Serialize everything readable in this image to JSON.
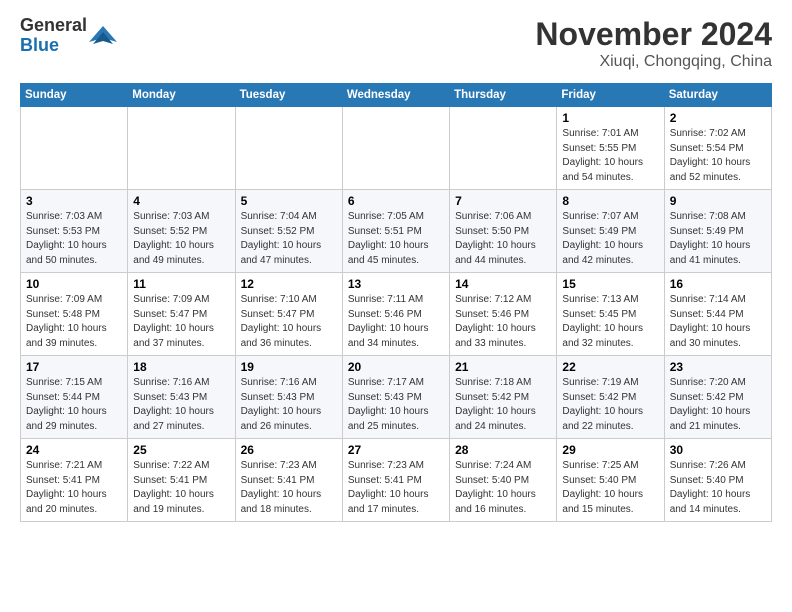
{
  "header": {
    "logo_general": "General",
    "logo_blue": "Blue",
    "month": "November 2024",
    "location": "Xiuqi, Chongqing, China"
  },
  "weekdays": [
    "Sunday",
    "Monday",
    "Tuesday",
    "Wednesday",
    "Thursday",
    "Friday",
    "Saturday"
  ],
  "weeks": [
    [
      {
        "day": "",
        "info": ""
      },
      {
        "day": "",
        "info": ""
      },
      {
        "day": "",
        "info": ""
      },
      {
        "day": "",
        "info": ""
      },
      {
        "day": "",
        "info": ""
      },
      {
        "day": "1",
        "info": "Sunrise: 7:01 AM\nSunset: 5:55 PM\nDaylight: 10 hours and 54 minutes."
      },
      {
        "day": "2",
        "info": "Sunrise: 7:02 AM\nSunset: 5:54 PM\nDaylight: 10 hours and 52 minutes."
      }
    ],
    [
      {
        "day": "3",
        "info": "Sunrise: 7:03 AM\nSunset: 5:53 PM\nDaylight: 10 hours and 50 minutes."
      },
      {
        "day": "4",
        "info": "Sunrise: 7:03 AM\nSunset: 5:52 PM\nDaylight: 10 hours and 49 minutes."
      },
      {
        "day": "5",
        "info": "Sunrise: 7:04 AM\nSunset: 5:52 PM\nDaylight: 10 hours and 47 minutes."
      },
      {
        "day": "6",
        "info": "Sunrise: 7:05 AM\nSunset: 5:51 PM\nDaylight: 10 hours and 45 minutes."
      },
      {
        "day": "7",
        "info": "Sunrise: 7:06 AM\nSunset: 5:50 PM\nDaylight: 10 hours and 44 minutes."
      },
      {
        "day": "8",
        "info": "Sunrise: 7:07 AM\nSunset: 5:49 PM\nDaylight: 10 hours and 42 minutes."
      },
      {
        "day": "9",
        "info": "Sunrise: 7:08 AM\nSunset: 5:49 PM\nDaylight: 10 hours and 41 minutes."
      }
    ],
    [
      {
        "day": "10",
        "info": "Sunrise: 7:09 AM\nSunset: 5:48 PM\nDaylight: 10 hours and 39 minutes."
      },
      {
        "day": "11",
        "info": "Sunrise: 7:09 AM\nSunset: 5:47 PM\nDaylight: 10 hours and 37 minutes."
      },
      {
        "day": "12",
        "info": "Sunrise: 7:10 AM\nSunset: 5:47 PM\nDaylight: 10 hours and 36 minutes."
      },
      {
        "day": "13",
        "info": "Sunrise: 7:11 AM\nSunset: 5:46 PM\nDaylight: 10 hours and 34 minutes."
      },
      {
        "day": "14",
        "info": "Sunrise: 7:12 AM\nSunset: 5:46 PM\nDaylight: 10 hours and 33 minutes."
      },
      {
        "day": "15",
        "info": "Sunrise: 7:13 AM\nSunset: 5:45 PM\nDaylight: 10 hours and 32 minutes."
      },
      {
        "day": "16",
        "info": "Sunrise: 7:14 AM\nSunset: 5:44 PM\nDaylight: 10 hours and 30 minutes."
      }
    ],
    [
      {
        "day": "17",
        "info": "Sunrise: 7:15 AM\nSunset: 5:44 PM\nDaylight: 10 hours and 29 minutes."
      },
      {
        "day": "18",
        "info": "Sunrise: 7:16 AM\nSunset: 5:43 PM\nDaylight: 10 hours and 27 minutes."
      },
      {
        "day": "19",
        "info": "Sunrise: 7:16 AM\nSunset: 5:43 PM\nDaylight: 10 hours and 26 minutes."
      },
      {
        "day": "20",
        "info": "Sunrise: 7:17 AM\nSunset: 5:43 PM\nDaylight: 10 hours and 25 minutes."
      },
      {
        "day": "21",
        "info": "Sunrise: 7:18 AM\nSunset: 5:42 PM\nDaylight: 10 hours and 24 minutes."
      },
      {
        "day": "22",
        "info": "Sunrise: 7:19 AM\nSunset: 5:42 PM\nDaylight: 10 hours and 22 minutes."
      },
      {
        "day": "23",
        "info": "Sunrise: 7:20 AM\nSunset: 5:42 PM\nDaylight: 10 hours and 21 minutes."
      }
    ],
    [
      {
        "day": "24",
        "info": "Sunrise: 7:21 AM\nSunset: 5:41 PM\nDaylight: 10 hours and 20 minutes."
      },
      {
        "day": "25",
        "info": "Sunrise: 7:22 AM\nSunset: 5:41 PM\nDaylight: 10 hours and 19 minutes."
      },
      {
        "day": "26",
        "info": "Sunrise: 7:23 AM\nSunset: 5:41 PM\nDaylight: 10 hours and 18 minutes."
      },
      {
        "day": "27",
        "info": "Sunrise: 7:23 AM\nSunset: 5:41 PM\nDaylight: 10 hours and 17 minutes."
      },
      {
        "day": "28",
        "info": "Sunrise: 7:24 AM\nSunset: 5:40 PM\nDaylight: 10 hours and 16 minutes."
      },
      {
        "day": "29",
        "info": "Sunrise: 7:25 AM\nSunset: 5:40 PM\nDaylight: 10 hours and 15 minutes."
      },
      {
        "day": "30",
        "info": "Sunrise: 7:26 AM\nSunset: 5:40 PM\nDaylight: 10 hours and 14 minutes."
      }
    ]
  ]
}
